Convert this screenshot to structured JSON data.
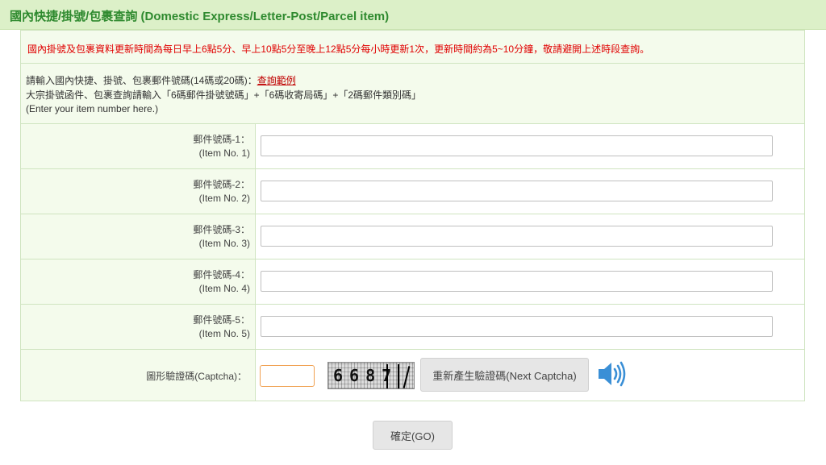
{
  "header": {
    "title": "國內快捷/掛號/包裹查詢 (Domestic Express/Letter-Post/Parcel item)"
  },
  "notice": {
    "text": "國內掛號及包裹資料更新時間為每日早上6點5分、早上10點5分至晚上12點5分每小時更新1次，更新時間約為5~10分鐘，敬請避開上述時段查詢。"
  },
  "instructions": {
    "line1_prefix": "請輸入國內快捷、掛號、包裹郵件號碼(14碼或20碼)：",
    "example_link": "查詢範例",
    "line2": "大宗掛號函件、包裹查詢請輸入「6碼郵件掛號號碼」+「6碼收寄局碼」+「2碼郵件類別碼」",
    "line3": "(Enter your item number here.)"
  },
  "items": [
    {
      "label_zh": "郵件號碼-1：",
      "label_en": "(Item No. 1)",
      "value": ""
    },
    {
      "label_zh": "郵件號碼-2：",
      "label_en": "(Item No. 2)",
      "value": ""
    },
    {
      "label_zh": "郵件號碼-3：",
      "label_en": "(Item No. 3)",
      "value": ""
    },
    {
      "label_zh": "郵件號碼-4：",
      "label_en": "(Item No. 4)",
      "value": ""
    },
    {
      "label_zh": "郵件號碼-5：",
      "label_en": "(Item No. 5)",
      "value": ""
    }
  ],
  "captcha": {
    "label": "圖形驗證碼(Captcha)：",
    "input_value": "",
    "image_text": "6687",
    "next_button": "重新產生驗證碼(Next Captcha)",
    "audio_icon": "speaker-icon"
  },
  "submit": {
    "label": "確定(GO)"
  },
  "colors": {
    "header_bg": "#dcf0c8",
    "header_text": "#2f8a2f",
    "notice_text": "#e00000",
    "link_text": "#c00000",
    "label_bg": "#f4fbec",
    "speaker": "#3a8fd6"
  }
}
